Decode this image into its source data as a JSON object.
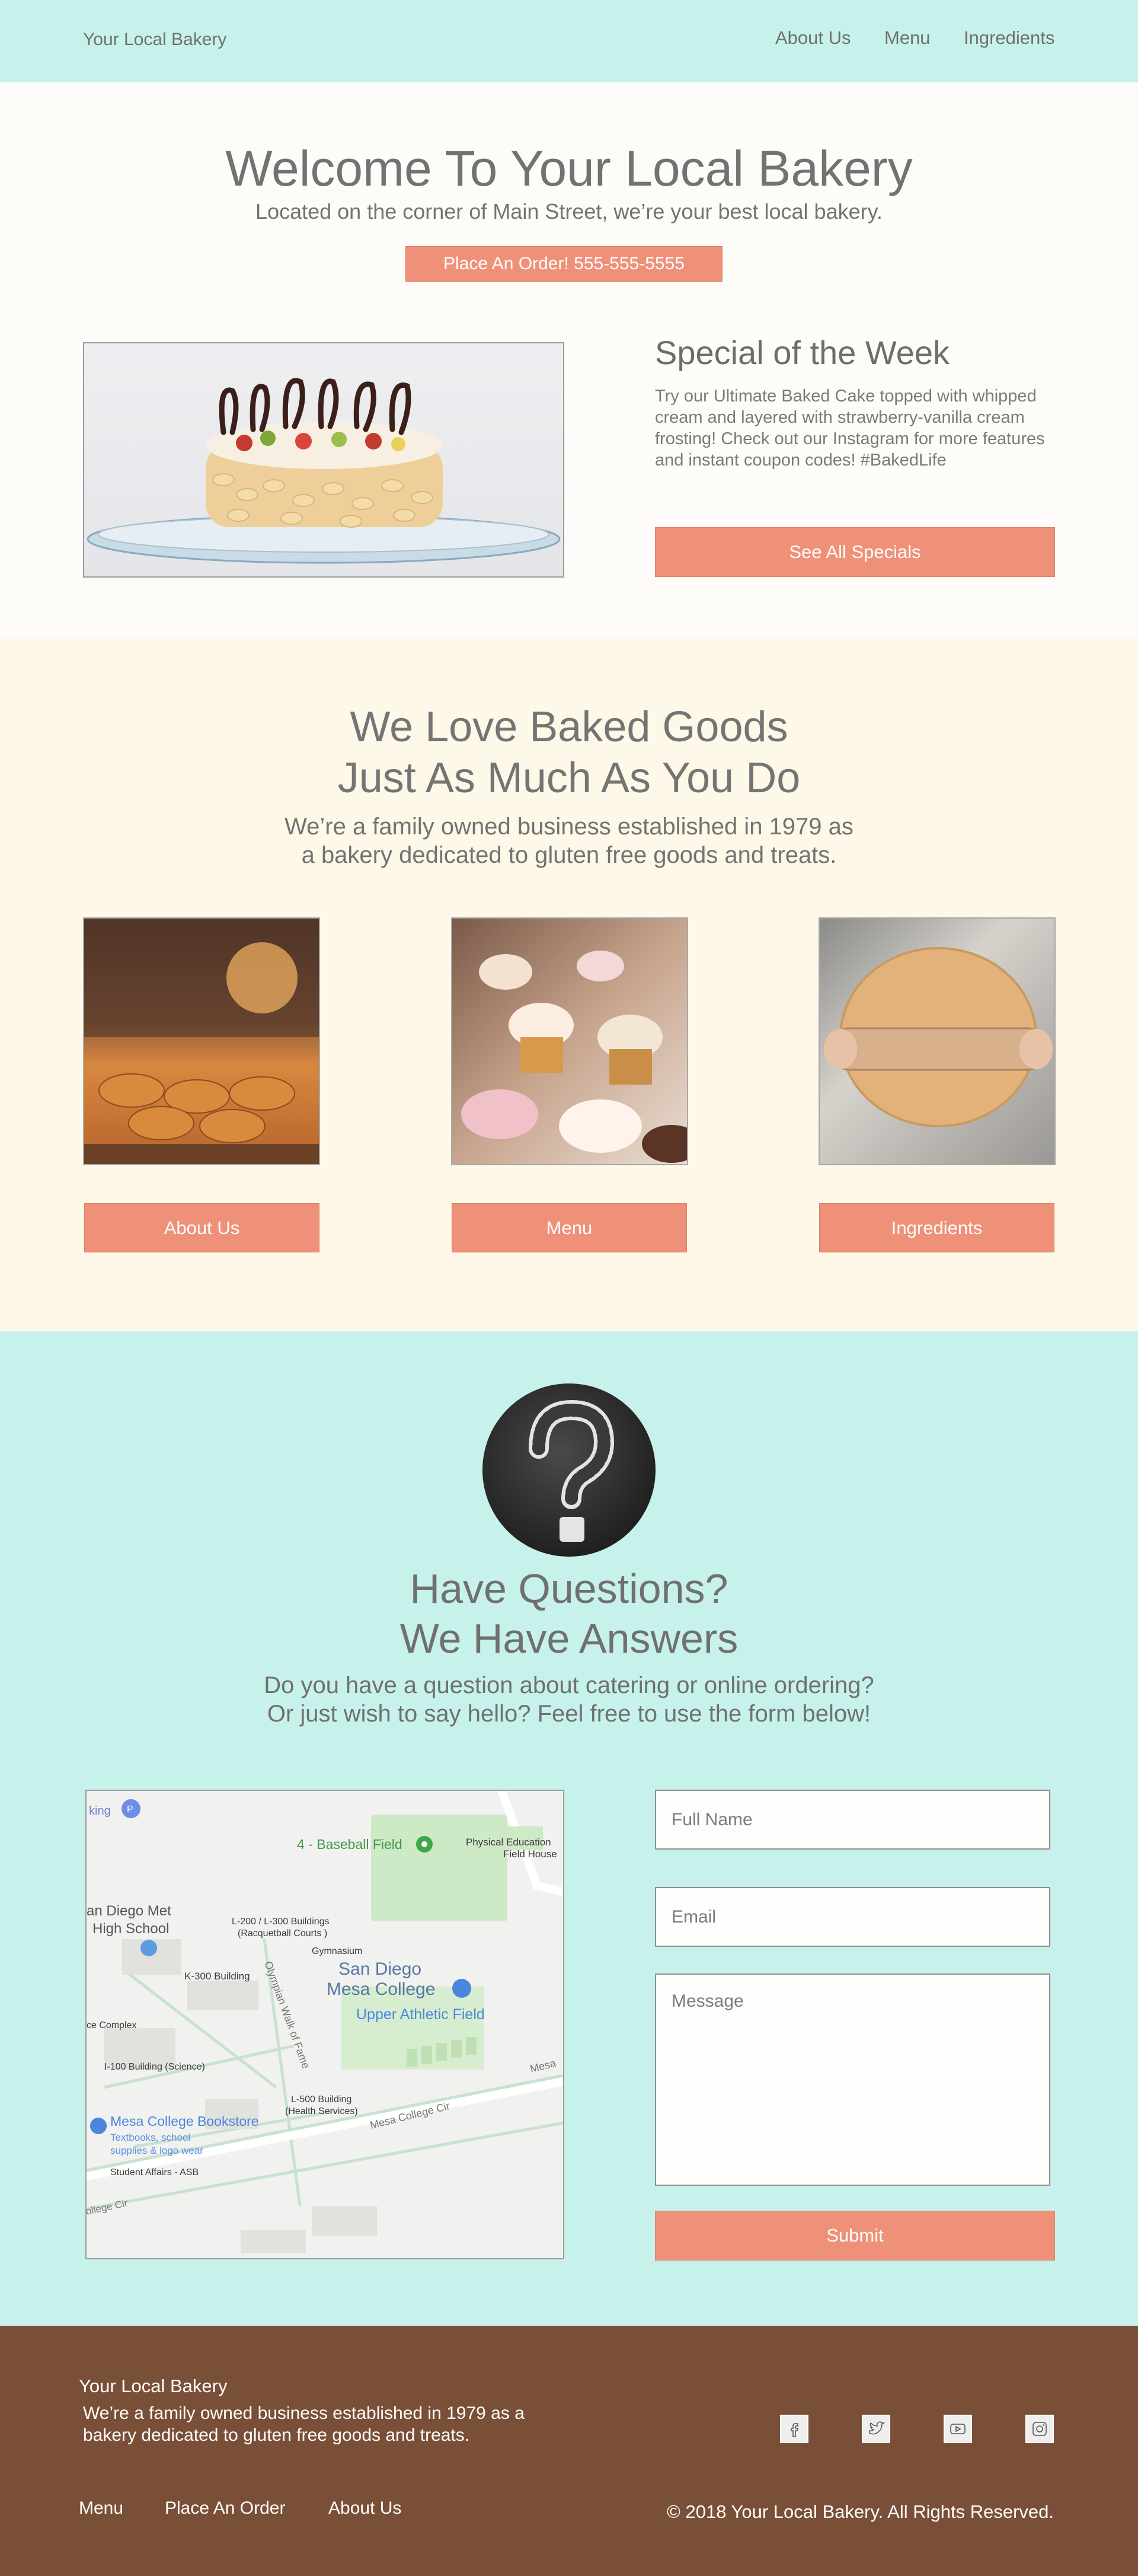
{
  "header": {
    "brand": "Your Local Bakery",
    "nav": [
      "About Us",
      "Menu",
      "Ingredients"
    ]
  },
  "hero": {
    "title": "Welcome To Your Local Bakery",
    "subtitle": "Located on the corner of Main Street,  we’re your best local bakery.",
    "order_button": "Place An Order! 555-555-5555"
  },
  "special": {
    "title": "Special of the Week",
    "body": "Try our Ultimate Baked Cake topped with whipped cream and layered with strawberry-vanilla cream frosting! Check out our Instagram for more features and instant coupon codes! #BakedLife",
    "button": "See All Specials"
  },
  "love": {
    "title_line1": "We Love Baked Goods",
    "title_line2": "Just As Much As You Do",
    "sub_line1": "We’re a family owned business established in 1979 as",
    "sub_line2": "a bakery dedicated to gluten free goods and treats.",
    "cards": [
      "About Us",
      "Menu",
      "Ingredients"
    ]
  },
  "questions": {
    "title_line1": "Have Questions?",
    "title_line2": "We Have Answers",
    "sub_line1": "Do you have a question about catering or online ordering?",
    "sub_line2": "Or just wish to say hello? Feel free to use the form below!",
    "form": {
      "name_placeholder": "Full Name",
      "email_placeholder": "Email",
      "message_placeholder": "Message",
      "submit": "Submit"
    }
  },
  "map": {
    "labels": {
      "parking": "king",
      "baseball": "4 - Baseball Field",
      "pe_field": "Physical Education",
      "pe_field2": "Field House",
      "met_high1": "an Diego Met",
      "met_high2": "High School",
      "l200a": "L-200 / L-300 Buildings",
      "l200b": "(Racquetball Courts )",
      "gym": "Gymnasium",
      "k300": "K-300 Building",
      "college1": "San Diego",
      "college2": "Mesa College",
      "athletic": "Upper Athletic Field",
      "complex": "ce Complex",
      "walk": "Olympian Walk of Fame",
      "i100": "I-100 Building (Science)",
      "l500a": "L-500 Building",
      "l500b": "(Health Services)",
      "mesa_cir": "Mesa College Cir",
      "mesa_short": "Mesa",
      "bookstore": "Mesa College Bookstore",
      "book_sub1": "Textbooks, school",
      "book_sub2": "supplies & logo wear",
      "student": "Student Affairs - ASB",
      "college_cir": "ollege Cir"
    }
  },
  "footer": {
    "brand": "Your Local Bakery",
    "desc": "We’re a family owned business established in 1979 as a bakery dedicated to gluten free goods and treats.",
    "links": [
      "Menu",
      "Place An Order",
      "About Us"
    ],
    "copyright": "© 2018 Your Local Bakery. All Rights Reserved.",
    "social_icons": [
      "facebook-icon",
      "twitter-icon",
      "youtube-icon",
      "instagram-icon"
    ]
  },
  "colors": {
    "mint": "#c6f2eb",
    "cream": "#fdf8e8",
    "salmon": "#ef9178",
    "brown": "#7a4f38"
  }
}
